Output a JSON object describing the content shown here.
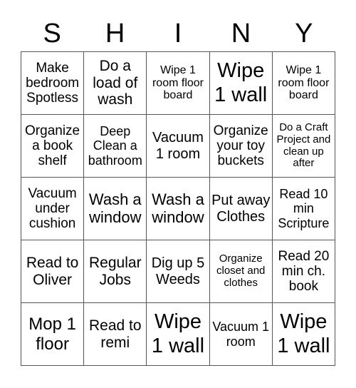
{
  "title_letters": [
    "S",
    "H",
    "I",
    "N",
    "Y"
  ],
  "cells": [
    "Make bedroom Spotless",
    "Do a load of wash",
    "Wipe 1 room floor board",
    "Wipe 1 wall",
    "Wipe 1 room floor board",
    "Organize a book shelf",
    "Deep Clean a bathroom",
    "Vacuum 1 room",
    "Organize your toy buckets",
    "Do a Craft Project and clean up after",
    "Vacuum under cushion",
    "Wash a window",
    "Wash a window",
    "Put away Clothes",
    "Read 10 min Scripture",
    "Read to Oliver",
    "Regular Jobs",
    "Dig up 5 Weeds",
    "Organize closet and clothes",
    "Read 20 min ch. book",
    "Mop 1 floor",
    "Read to remi",
    "Wipe 1 wall",
    "Vacuum 1 room",
    "Wipe 1 wall"
  ]
}
